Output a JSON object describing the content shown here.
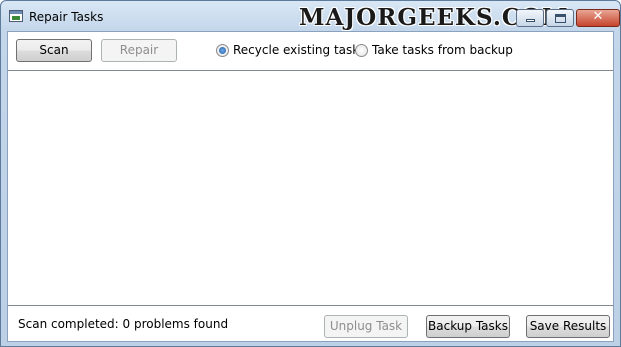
{
  "window": {
    "title": "Repair Tasks",
    "watermark": "MAJORGEEKS.COM",
    "controls": {
      "minimize": "minimize-icon",
      "maximize": "maximize-icon",
      "close": "close-icon",
      "close_glyph": "✕"
    }
  },
  "toolbar": {
    "scan_label": "Scan",
    "repair_label": "Repair",
    "options": [
      {
        "label": "Recycle existing tasks",
        "selected": true
      },
      {
        "label": "Take tasks from backup",
        "selected": false
      }
    ]
  },
  "results": {
    "items": []
  },
  "footer": {
    "status": "Scan completed: 0 problems found",
    "unplug_label": "Unplug Task",
    "backup_label": "Backup Tasks",
    "save_label": "Save Results"
  },
  "colors": {
    "accent": "#1e5aa8",
    "disabled_text": "#8e8e8e",
    "close_button": "#c5452e"
  }
}
